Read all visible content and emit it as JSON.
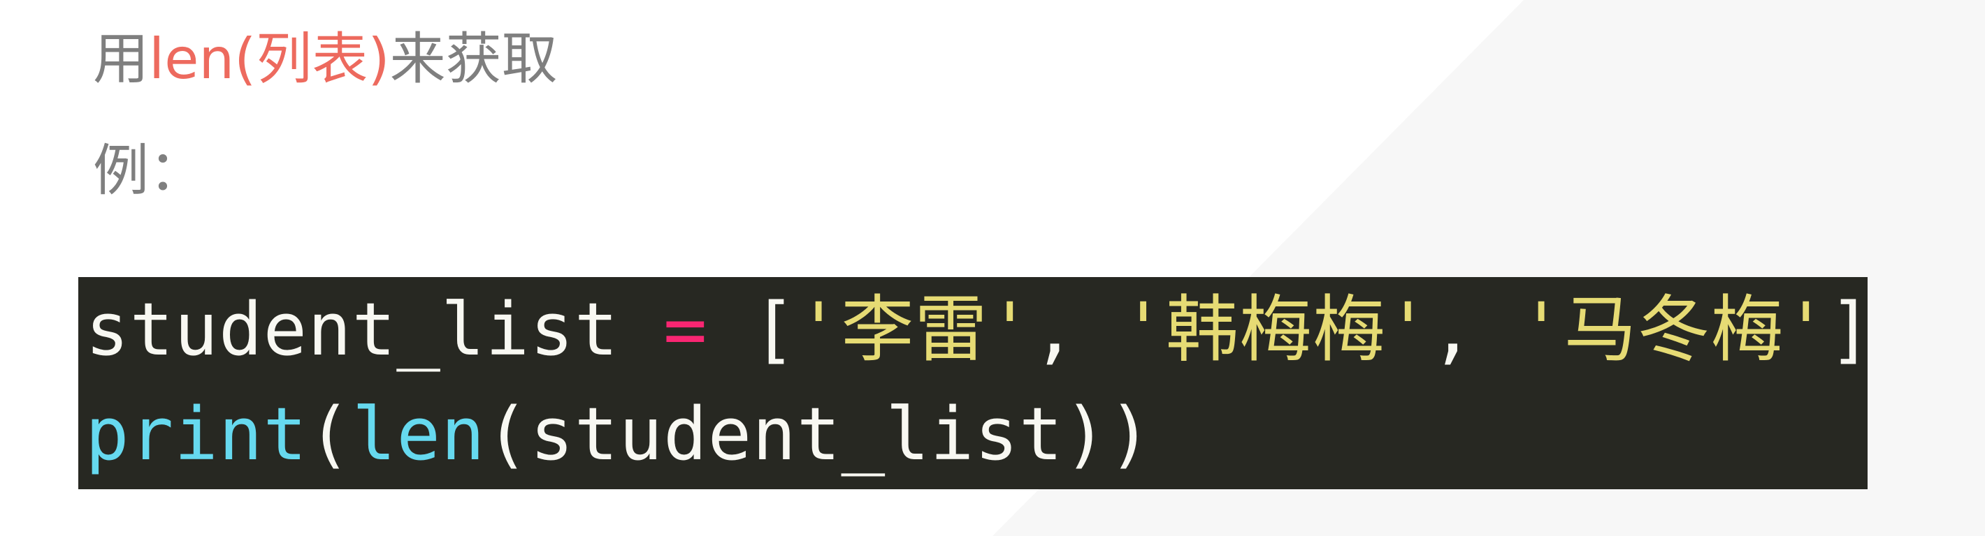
{
  "heading": {
    "prefix": "用",
    "highlight": "len(列表)",
    "suffix": "来获取"
  },
  "example_label": "例：",
  "code": {
    "line1": {
      "var": "student_list",
      "op": "=",
      "open": "[",
      "s1": "'李雷'",
      "comma1": ",",
      "s2": "'韩梅梅'",
      "comma2": ",",
      "s3": "'马冬梅'",
      "close": "]"
    },
    "line2": {
      "print": "print",
      "paren1": "(",
      "len": "len",
      "paren2": "(",
      "arg": "student_list",
      "close": "))"
    }
  },
  "colors": {
    "body_text": "#7f7f7f",
    "highlight": "#ed6a5e",
    "code_bg": "#272822",
    "code_plain": "#f8f8f2",
    "code_operator": "#f92672",
    "code_string": "#e6db74",
    "code_builtin": "#66d9ef"
  }
}
